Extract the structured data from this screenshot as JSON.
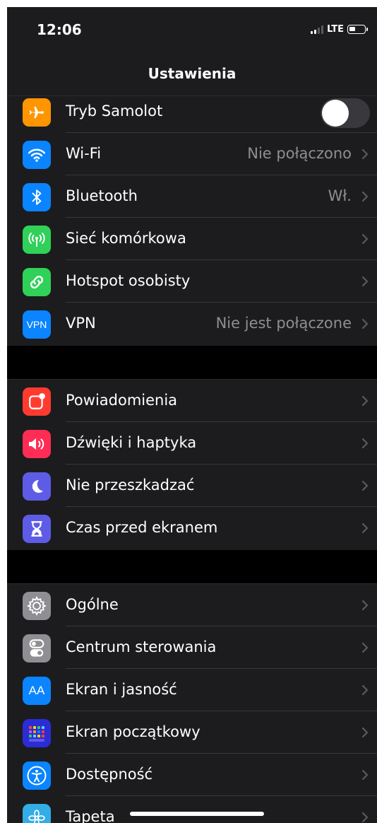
{
  "status": {
    "time": "12:06",
    "network": "LTE"
  },
  "nav": {
    "title": "Ustawienia"
  },
  "group1": [
    {
      "label": "Tryb Samolot",
      "icon": "airplane-icon",
      "color": "#ff9500",
      "toggle": false
    },
    {
      "label": "Wi-Fi",
      "value": "Nie połączono",
      "icon": "wifi-icon",
      "color": "#0a84ff"
    },
    {
      "label": "Bluetooth",
      "value": "Wł.",
      "icon": "bluetooth-icon",
      "color": "#0a84ff"
    },
    {
      "label": "Sieć komórkowa",
      "icon": "cellular-icon",
      "color": "#30d158"
    },
    {
      "label": "Hotspot osobisty",
      "icon": "hotspot-icon",
      "color": "#30d158"
    },
    {
      "label": "VPN",
      "value": "Nie jest połączone",
      "icon": "vpn-icon",
      "icon_text": "VPN",
      "color": "#0a84ff"
    }
  ],
  "group2": [
    {
      "label": "Powiadomienia",
      "icon": "notifications-icon",
      "color": "#ff3b30"
    },
    {
      "label": "Dźwięki i haptyka",
      "icon": "speaker-icon",
      "color": "#ff2d55"
    },
    {
      "label": "Nie przeszkadzać",
      "icon": "moon-icon",
      "color": "#5e5ce6"
    },
    {
      "label": "Czas przed ekranem",
      "icon": "hourglass-icon",
      "color": "#5e5ce6"
    }
  ],
  "group3": [
    {
      "label": "Ogólne",
      "icon": "gear-icon",
      "color": "#8e8e93"
    },
    {
      "label": "Centrum sterowania",
      "icon": "control-center-icon",
      "color": "#8e8e93"
    },
    {
      "label": "Ekran i jasność",
      "icon": "display-brightness-icon",
      "icon_text": "AA",
      "color": "#0a84ff"
    },
    {
      "label": "Ekran początkowy",
      "icon": "home-screen-icon",
      "color": "#2c2cd6"
    },
    {
      "label": "Dostępność",
      "icon": "accessibility-icon",
      "color": "#0a84ff"
    },
    {
      "label": "Tapeta",
      "icon": "wallpaper-icon",
      "color": "#32ade6"
    }
  ]
}
